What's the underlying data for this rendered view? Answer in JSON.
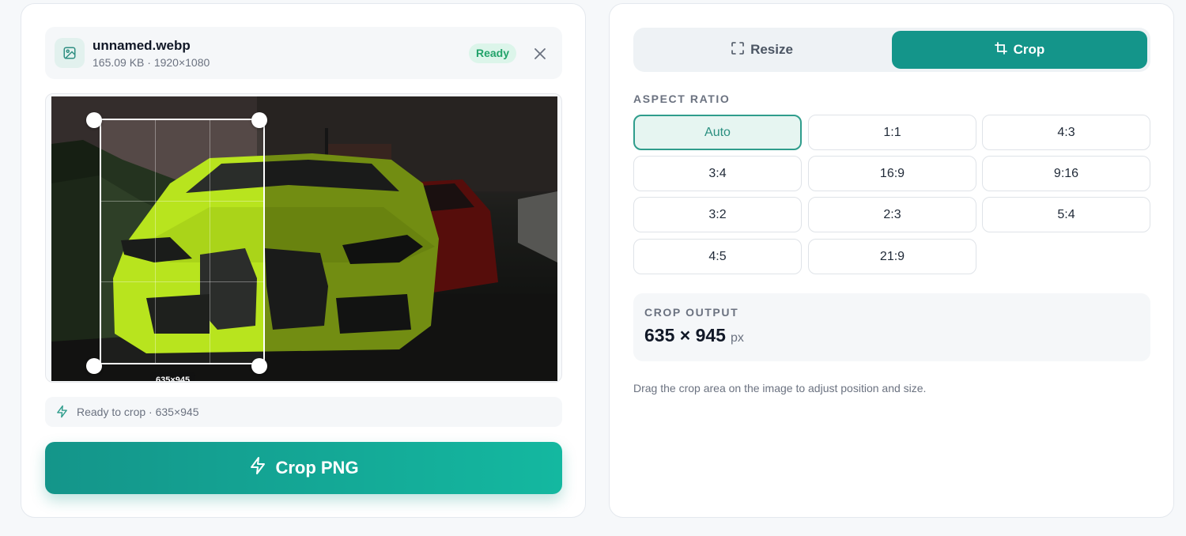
{
  "file": {
    "name": "unnamed.webp",
    "meta": "165.09 KB · 1920×1080",
    "badge": "Ready"
  },
  "preview": {
    "crop_label": "635×945"
  },
  "status": {
    "text": "Ready to crop · 635×945"
  },
  "primary_action": {
    "label": "Crop PNG"
  },
  "mode_toggle": {
    "resize_label": "Resize",
    "crop_label": "Crop",
    "active": "Crop"
  },
  "aspect_ratio": {
    "heading": "ASPECT RATIO",
    "active": "Auto",
    "options": [
      "Auto",
      "1:1",
      "4:3",
      "3:4",
      "16:9",
      "9:16",
      "3:2",
      "2:3",
      "5:4",
      "4:5",
      "21:9"
    ]
  },
  "crop_output": {
    "heading": "CROP OUTPUT",
    "value": "635 × 945",
    "unit": "px"
  },
  "hint": "Drag the crop area on the image to adjust position and size.",
  "colors": {
    "accent": "#14958a",
    "badge_bg": "#dcf5ea",
    "badge_text": "#22a36a",
    "active_ratio_bg": "#e6f5f1"
  }
}
